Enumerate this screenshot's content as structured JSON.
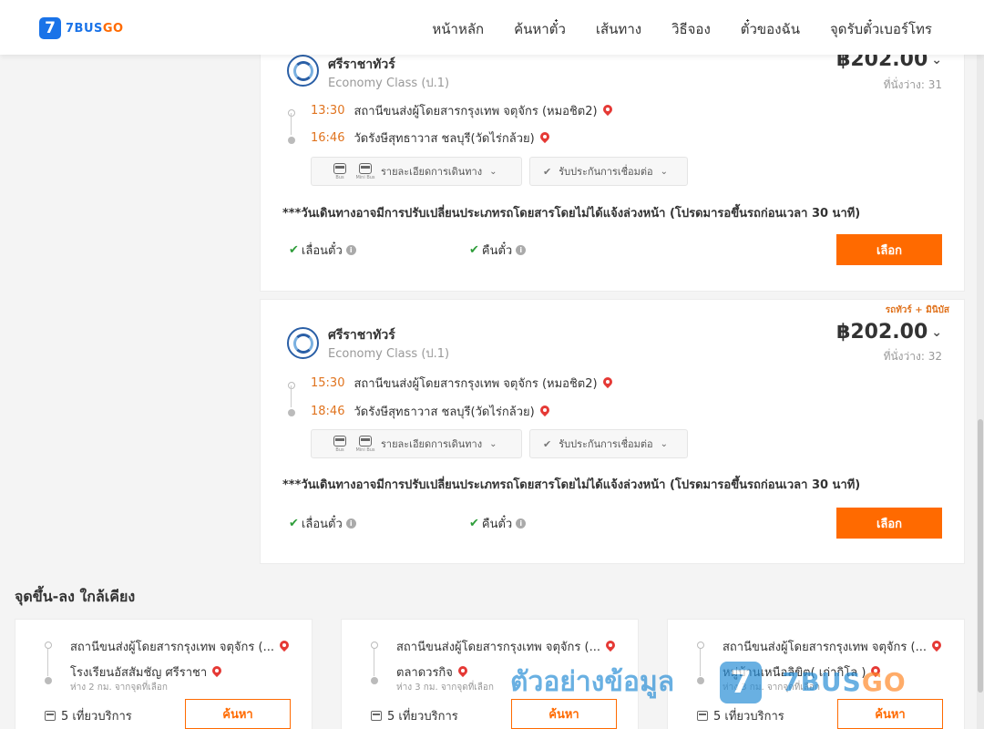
{
  "header": {
    "logo_badge": "7",
    "logo_bus": "7BUS",
    "logo_go": "GO",
    "nav": [
      "หน้าหลัก",
      "ค้นหาตั๋ว",
      "เส้นทาง",
      "วิธีจอง",
      "ตั๋วของฉัน",
      "จุดรับตั๋วเบอร์โทร"
    ]
  },
  "colors": {
    "accent": "#ff6a00",
    "brand": "#1a73e8",
    "time": "#e0731e",
    "check": "#2e9d3a"
  },
  "trips": [
    {
      "tag": "",
      "operator": "ศรีราชาทัวร์",
      "class": "Economy Class (ป.1)",
      "price": "฿202.00",
      "seats": "ที่นั่งว่าง: 31",
      "depart_time": "13:30",
      "depart_stop": "สถานีขนส่งผู้โดยสารกรุงเทพ จตุจักร (หมอชิต2)",
      "arrive_time": "16:46",
      "arrive_stop": "วัดรังษีสุทธาวาส ชลบุรี(วัดไร่กล้วย)",
      "bus_label": "Bus",
      "minibus_label": "Mini Bus",
      "detail_label": "รายละเอียดการเดินทาง",
      "insurance_label": "รับประกันการเชื่อมต่อ",
      "notice": "***วันเดินทางอาจมีการปรับเปลี่ยนประเภทรถโดยสารโดยไม่ได้แจ้งล่วงหน้า (โปรดมารอขึ้นรถก่อนเวลา 30 นาที)",
      "reschedule": "เลื่อนตั๋ว",
      "refund": "คืนตั๋ว",
      "select": "เลือก"
    },
    {
      "tag": "รถทัวร์ + มินิบัส",
      "operator": "ศรีราชาทัวร์",
      "class": "Economy Class (ป.1)",
      "price": "฿202.00",
      "seats": "ที่นั่งว่าง: 32",
      "depart_time": "15:30",
      "depart_stop": "สถานีขนส่งผู้โดยสารกรุงเทพ จตุจักร (หมอชิต2)",
      "arrive_time": "18:46",
      "arrive_stop": "วัดรังษีสุทธาวาส ชลบุรี(วัดไร่กล้วย)",
      "bus_label": "Bus",
      "minibus_label": "Mini Bus",
      "detail_label": "รายละเอียดการเดินทาง",
      "insurance_label": "รับประกันการเชื่อมต่อ",
      "notice": "***วันเดินทางอาจมีการปรับเปลี่ยนประเภทรถโดยสารโดยไม่ได้แจ้งล่วงหน้า (โปรดมารอขึ้นรถก่อนเวลา 30 นาที)",
      "reschedule": "เลื่อนตั๋ว",
      "refund": "คืนตั๋ว",
      "select": "เลือก"
    }
  ],
  "nearby": {
    "title": "จุดขึ้น-ลง ใกล้เคียง",
    "cards": [
      {
        "from": "สถานีขนส่งผู้โดยสารกรุงเทพ จตุจักร (...",
        "to": "โรงเรียนอัสสัมชัญ ศรีราชา",
        "distance": "ห่าง 2 กม. จากจุดที่เลือก",
        "trips": "5 เที่ยวบริการ",
        "search": "ค้นหา"
      },
      {
        "from": "สถานีขนส่งผู้โดยสารกรุงเทพ จตุจักร (...",
        "to": "ตลาดวรกิจ",
        "distance": "ห่าง 3 กม. จากจุดที่เลือก",
        "trips": "5 เที่ยวบริการ",
        "search": "ค้นหา"
      },
      {
        "from": "สถานีขนส่งผู้โดยสารกรุงเทพ จตุจักร (...",
        "to": "หมู่บ้านเหนือลิขิต( เก่ากิโล )",
        "distance": "ห่าง 3 กม. จากจุดที่เลือก",
        "trips": "5 เที่ยวบริการ",
        "search": "ค้นหา"
      }
    ]
  },
  "watermark": {
    "text": "ตัวอย่างข้อมูล",
    "badge": "7",
    "logo_bus": "7BUS",
    "logo_go": "GO"
  }
}
